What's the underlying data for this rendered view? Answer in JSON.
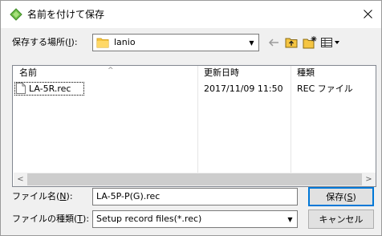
{
  "title": "名前を付けて保存",
  "location": {
    "label_prefix": "保存する場所(",
    "label_key": "I",
    "label_suffix": "):",
    "value": "lanio"
  },
  "columns": {
    "name": "名前",
    "date": "更新日時",
    "type": "種類"
  },
  "files": [
    {
      "name": "LA-5R.rec",
      "date": "2017/11/09 11:50",
      "type": "REC ファイル"
    }
  ],
  "filename": {
    "label_prefix": "ファイル名(",
    "label_key": "N",
    "label_suffix": "):",
    "value": "LA-5P-P(G).rec"
  },
  "filetype": {
    "label_prefix": "ファイルの種類(",
    "label_key": "T",
    "label_suffix": "):",
    "value": "Setup record files(*.rec)"
  },
  "buttons": {
    "save_prefix": "保存(",
    "save_key": "S",
    "save_suffix": ")",
    "cancel": "キャンセル"
  },
  "icons": {
    "app": "app-icon",
    "close": "close-icon",
    "folder": "folder-icon",
    "back": "back-arrow-icon",
    "up": "up-folder-icon",
    "new_folder": "new-folder-icon",
    "view_menu": "view-menu-icon",
    "file": "file-icon"
  },
  "colors": {
    "accent": "#0078d7",
    "folder": "#f5c542",
    "dialog_bg": "#f0f0f0"
  }
}
